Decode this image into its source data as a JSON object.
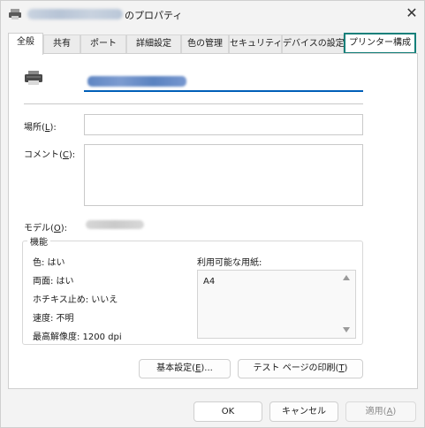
{
  "window": {
    "title_suffix": "のプロパティ",
    "close_glyph": "✕"
  },
  "tabs": [
    {
      "label": "全般"
    },
    {
      "label": "共有"
    },
    {
      "label": "ポート"
    },
    {
      "label": "詳細設定"
    },
    {
      "label": "色の管理"
    },
    {
      "label": "セキュリティ"
    },
    {
      "label": "デバイスの設定"
    },
    {
      "label": "プリンター構成"
    }
  ],
  "general": {
    "location_label_pre": "場所(",
    "location_key": "L",
    "location_label_post": "):",
    "location_value": "",
    "comment_label_pre": "コメント(",
    "comment_key": "C",
    "comment_label_post": "):",
    "comment_value": "",
    "model_label_pre": "モデル(",
    "model_key": "O",
    "model_label_post": "):"
  },
  "features": {
    "legend": "機能",
    "color": "色: はい",
    "duplex": "両面: はい",
    "staple": "ホチキス止め: いいえ",
    "speed": "速度: 不明",
    "resolution": "最高解像度: 1200 dpi",
    "papers_label": "利用可能な用紙:",
    "papers": [
      "A4"
    ]
  },
  "buttons": {
    "preferences_pre": "基本設定(",
    "preferences_key": "E",
    "preferences_post": ")...",
    "test_page_pre": "テスト ページの印刷(",
    "test_page_key": "T",
    "test_page_post": ")",
    "ok": "OK",
    "cancel": "キャンセル",
    "apply_pre": "適用(",
    "apply_key": "A",
    "apply_post": ")"
  },
  "colors": {
    "accent": "#005fb8",
    "focus_ring": "#15807a"
  },
  "icons": {
    "title": "printer-icon",
    "main": "printer-icon"
  }
}
